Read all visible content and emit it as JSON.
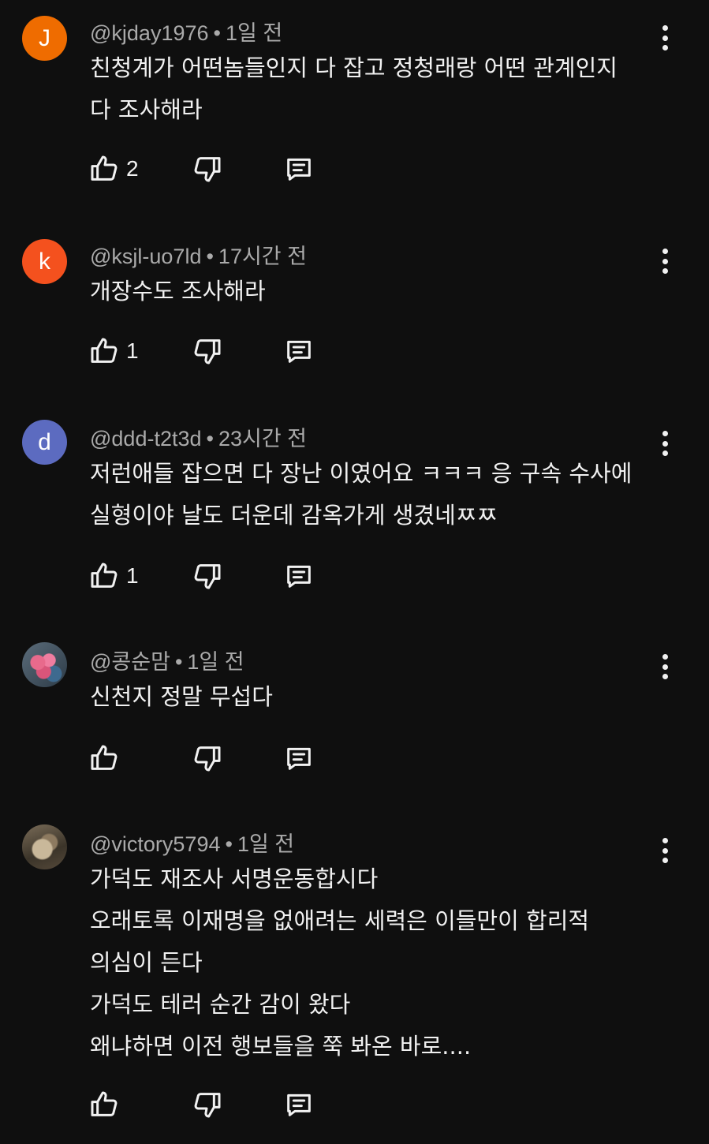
{
  "comments": [
    {
      "handle": "@kjday1976",
      "time": "1일 전",
      "avatar": {
        "letter": "J",
        "color": "#ef6c00"
      },
      "lines": [
        "친청계가 어떤놈들인지 다 잡고 정청래랑 어떤 관계인지",
        "다 조사해라"
      ],
      "likes": "2"
    },
    {
      "handle": "@ksjl-uo7ld",
      "time": "17시간 전",
      "avatar": {
        "letter": "k",
        "color": "#f4511e"
      },
      "lines": [
        "개장수도 조사해라"
      ],
      "likes": "1"
    },
    {
      "handle": "@ddd-t2t3d",
      "time": "23시간 전",
      "avatar": {
        "letter": "d",
        "color": "#5c6bc0"
      },
      "lines": [
        "저런애들 잡으면 다 장난 이였어요 ㅋㅋㅋ 응 구속 수사에",
        "실형이야 날도 더운데 감옥가게 생겼네ㅉㅉ"
      ],
      "likes": "1"
    },
    {
      "handle": "@콩순맘",
      "time": "1일 전",
      "avatar": {
        "letter": "",
        "color": "#4a5a66"
      },
      "lines": [
        "신천지 정말 무섭다"
      ],
      "likes": ""
    },
    {
      "handle": "@victory5794",
      "time": "1일 전",
      "avatar": {
        "letter": "",
        "color": "#5a4d3e"
      },
      "lines": [
        "가덕도 재조사 서명운동합시다",
        "오래토록 이재명을 없애려는 세력은 이들만이 합리적",
        "의심이 든다",
        "가덕도 테러 순간 감이 왔다",
        "왜냐하면 이전 행보들을 쭉 봐온 바로...."
      ],
      "likes": ""
    }
  ],
  "separator": "•",
  "icons": {
    "like": "thumb-up-icon",
    "dislike": "thumb-down-icon",
    "reply": "reply-comment-icon",
    "menu": "more-vert-icon"
  }
}
